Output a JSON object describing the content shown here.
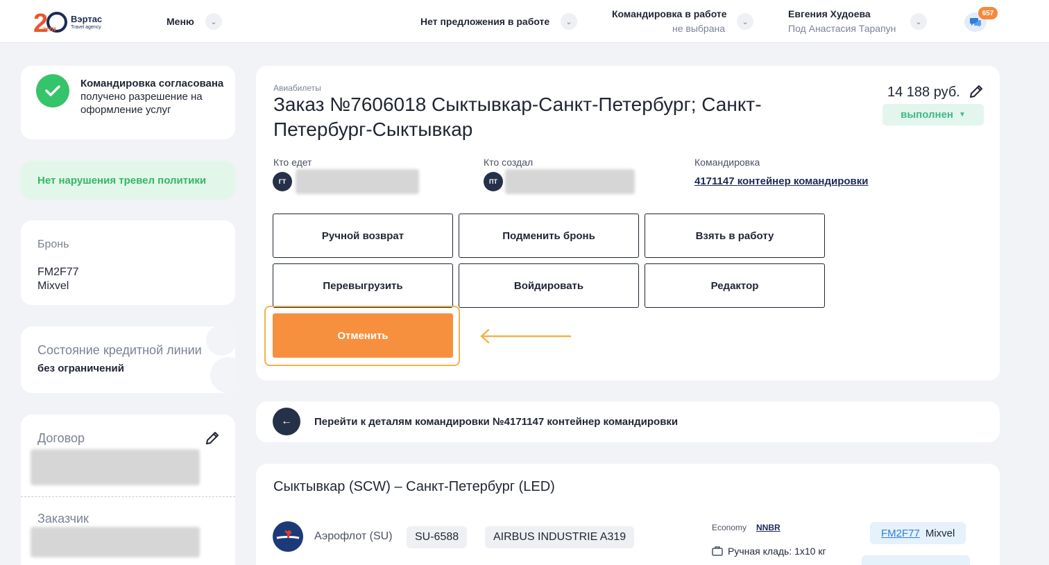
{
  "header": {
    "logo_text": "Вэртас",
    "logo_sub": "Travel agency",
    "logo_years": "лет",
    "menu_label": "Меню",
    "offer_label": "Нет предложения в работе",
    "trip_label": "Командировка в работе",
    "trip_sub": "не выбрана",
    "user_name": "Евгения Худоева",
    "user_sub": "Под Анастасия Тарапун",
    "chat_badge": "657"
  },
  "sidebar": {
    "approval_title": "Командировка согласована",
    "approval_sub": "получено разрешение на оформление услуг",
    "policy_text": "Нет нарушения тревел политики",
    "booking_label": "Бронь",
    "booking_code": "FM2F77",
    "booking_provider": "Mixvel",
    "credit_label": "Состояние кредитной линии",
    "credit_value": "без ограничений",
    "contract_label": "Договор",
    "customer_label": "Заказчик"
  },
  "order": {
    "category": "Авиабилеты",
    "title": "Заказ №7606018 Сыктывкар-Санкт-Петербург; Санкт-Петербург-Сыктывкар",
    "title_line1": "Заказ №7606018 Сыктывкар-Санкт-Петербург; Санкт-",
    "title_line2": "Петербург-Сыктывкар",
    "price": "14 188 руб.",
    "status": "выполнен",
    "who_goes_label": "Кто едет",
    "who_goes_initials": "ГТ",
    "creator_label": "Кто создал",
    "creator_initials": "ПТ",
    "trip_label": "Командировка",
    "trip_link": "4171147 контейнер командировки"
  },
  "actions": {
    "manual_refund": "Ручной возврат",
    "replace_booking": "Подменить бронь",
    "take_to_work": "Взять в работу",
    "reupload": "Перевыгрузить",
    "void": "Войдировать",
    "editor": "Редактор",
    "cancel": "Отменить"
  },
  "trip_nav": {
    "text": "Перейти к деталям командировки №4171147 контейнер командировки"
  },
  "segment": {
    "route": "Сыктывкар (SCW) – Санкт-Петербург (LED)",
    "airline": "Аэрофлот (SU)",
    "flight": "SU-6588",
    "aircraft": "AIRBUS INDUSTRIE A319",
    "class_label": "Economy",
    "fare_code": "NNBR",
    "baggage": "Ручная кладь: 1x10 кг",
    "booking_code": "FM2F77",
    "booking_provider": "Mixvel"
  },
  "colors": {
    "accent_orange": "#f7903e",
    "highlight": "#f0b24a",
    "success_green": "#35c46a",
    "navy": "#253049"
  }
}
